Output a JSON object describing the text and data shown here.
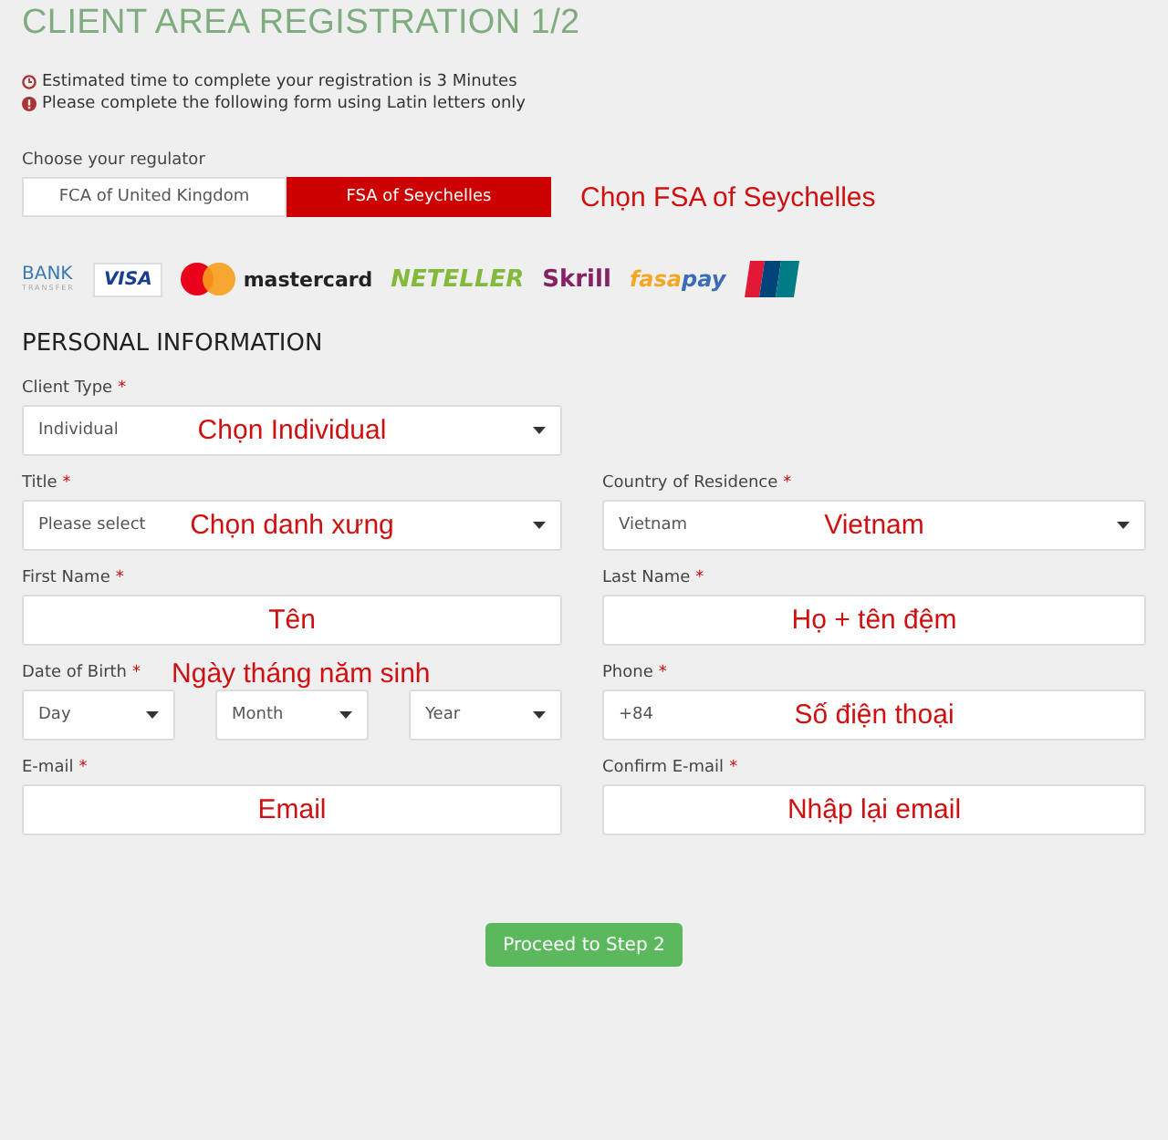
{
  "title": "CLIENT AREA REGISTRATION 1/2",
  "notices": [
    {
      "kind": "clock",
      "text": "Estimated time to complete your registration is 3 Minutes"
    },
    {
      "kind": "alert",
      "text": "Please complete the following form using Latin letters only"
    }
  ],
  "regulator": {
    "label": "Choose your regulator",
    "options": [
      {
        "label": "FCA of United Kingdom",
        "selected": false
      },
      {
        "label": "FSA of Seychelles",
        "selected": true
      }
    ],
    "annotation": "Chọn FSA of Seychelles"
  },
  "payment_logos": [
    {
      "kind": "bank",
      "label": "BANK",
      "sublabel": "TRANSFER"
    },
    {
      "kind": "visa",
      "label": "VISA"
    },
    {
      "kind": "mastercard",
      "label": "mastercard"
    },
    {
      "kind": "neteller",
      "label": "NETELLER"
    },
    {
      "kind": "skrill",
      "label": "Skrill"
    },
    {
      "kind": "fasapay",
      "label": "fasa",
      "label2": "pay"
    },
    {
      "kind": "unionpay"
    }
  ],
  "section_title": "PERSONAL INFORMATION",
  "rows": [
    [
      {
        "kind": "select",
        "label": "Client Type",
        "required_mark": "*",
        "value": "Individual",
        "annotation": "Chọn Individual"
      },
      null
    ],
    [
      {
        "kind": "select",
        "label": "Title",
        "required_mark": "*",
        "placeholder": "Please select",
        "annotation": "Chọn danh xưng"
      },
      {
        "kind": "select",
        "label": "Country of Residence",
        "required_mark": "*",
        "value": "Vietnam",
        "annotation": "Vietnam"
      }
    ],
    [
      {
        "kind": "text",
        "label": "First Name",
        "required_mark": "*",
        "annotation": "Tên"
      },
      {
        "kind": "text",
        "label": "Last Name",
        "required_mark": "*",
        "annotation": "Họ + tên đệm"
      }
    ],
    [
      {
        "kind": "date",
        "label": "Date of Birth",
        "required_mark": "*",
        "label_annotation": "Ngày tháng năm sinh",
        "parts": [
          "Day",
          "Month",
          "Year"
        ]
      },
      {
        "kind": "text",
        "label": "Phone",
        "required_mark": "*",
        "value": "+84",
        "annotation": "Số điện thoại"
      }
    ],
    [
      {
        "kind": "text",
        "label": "E-mail",
        "required_mark": "*",
        "annotation": "Email"
      },
      {
        "kind": "text",
        "label": "Confirm E-mail",
        "required_mark": "*",
        "annotation": "Nhập lại email"
      }
    ]
  ],
  "submit": "Proceed to Step 2"
}
